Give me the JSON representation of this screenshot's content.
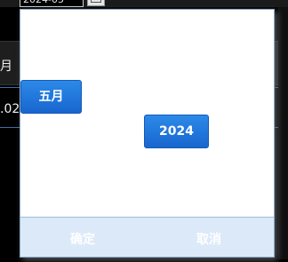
{
  "background": {
    "date_field_value": "2024-05",
    "row1_text": "月",
    "row2_text": ".02"
  },
  "picker": {
    "month_value": "五月",
    "year_value": "2024",
    "confirm_label": "确定",
    "cancel_label": "取消"
  },
  "icons": {
    "calendar_button": "calendar-icon"
  },
  "colors": {
    "accent": "#1f76db",
    "footer_bg": "#dce9f8"
  }
}
